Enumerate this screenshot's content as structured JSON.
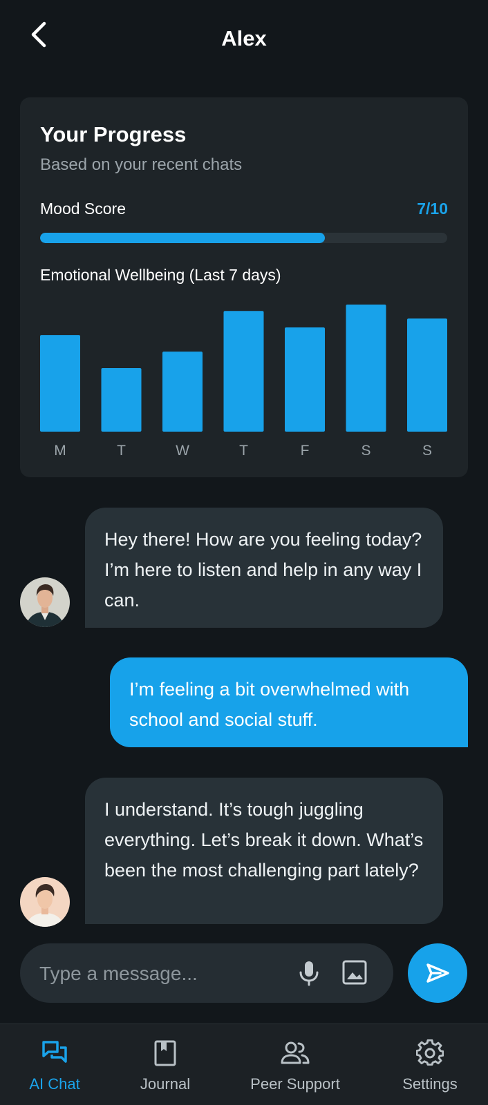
{
  "header": {
    "title": "Alex",
    "back_icon": "chevron-left-icon"
  },
  "progress": {
    "title": "Your Progress",
    "subtitle": "Based on your recent chats",
    "mood_label": "Mood Score",
    "mood_value": "7/10",
    "mood_fraction": 0.7,
    "chart_title": "Emotional Wellbeing (Last 7 days)"
  },
  "chart_data": {
    "type": "bar",
    "categories": [
      "M",
      "T",
      "W",
      "T",
      "F",
      "S",
      "S"
    ],
    "values": [
      0.76,
      0.5,
      0.63,
      0.95,
      0.82,
      1.0,
      0.89
    ],
    "color": "#18a2ea"
  },
  "messages": [
    {
      "role": "ai",
      "text": "Hey there! How are you feeling today? I’m here to listen and help in any way I can."
    },
    {
      "role": "user",
      "text": "I’m feeling a bit overwhelmed with school and social stuff."
    },
    {
      "role": "ai",
      "text": "I understand. It’s tough juggling everything. Let’s break it down. What’s been the most challenging part lately?"
    }
  ],
  "composer": {
    "placeholder": "Type a message...",
    "mic_icon": "mic-icon",
    "image_icon": "image-icon",
    "send_icon": "send-icon"
  },
  "nav": {
    "items": [
      {
        "label": "AI Chat",
        "icon": "chat-icon",
        "active": true
      },
      {
        "label": "Journal",
        "icon": "journal-icon",
        "active": false
      },
      {
        "label": "Peer Support",
        "icon": "people-icon",
        "active": false
      },
      {
        "label": "Settings",
        "icon": "gear-icon",
        "active": false
      }
    ]
  },
  "colors": {
    "accent": "#17a2ea",
    "background": "#12171b",
    "card": "#1e2428",
    "ai_bubble": "#283238"
  }
}
